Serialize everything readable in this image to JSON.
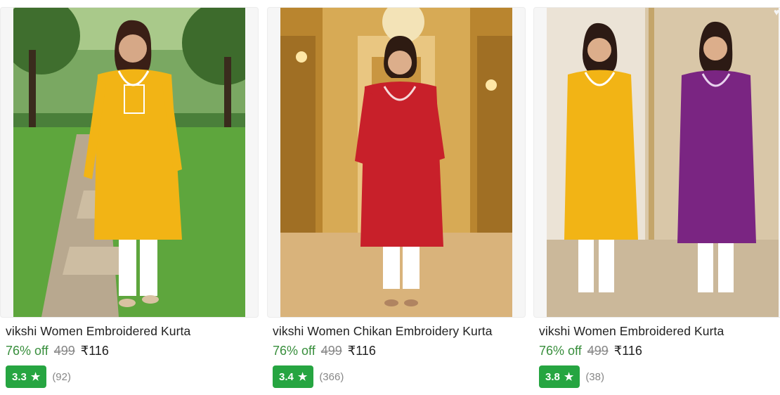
{
  "products": [
    {
      "title": "vikshi Women Embroidered Kurta",
      "discount": "76% off",
      "mrp": "499",
      "price": "₹116",
      "rating": "3.3",
      "rating_count": "(92)",
      "kurta_color": "#f2b415"
    },
    {
      "title": "vikshi Women Chikan Embroidery Kurta",
      "discount": "76% off",
      "mrp": "499",
      "price": "₹116",
      "rating": "3.4",
      "rating_count": "(366)",
      "kurta_color": "#c8202a"
    },
    {
      "title": "vikshi Women Embroidered Kurta",
      "discount": "76% off",
      "mrp": "499",
      "price": "₹116",
      "rating": "3.8",
      "rating_count": "(38)",
      "kurta_color": "#f2b415"
    }
  ],
  "icons": {
    "star": "star-icon",
    "wishlist": "heart-icon"
  },
  "colors": {
    "discount_green": "#388e3c",
    "rating_badge": "#26a541",
    "muted_text": "#878787"
  }
}
